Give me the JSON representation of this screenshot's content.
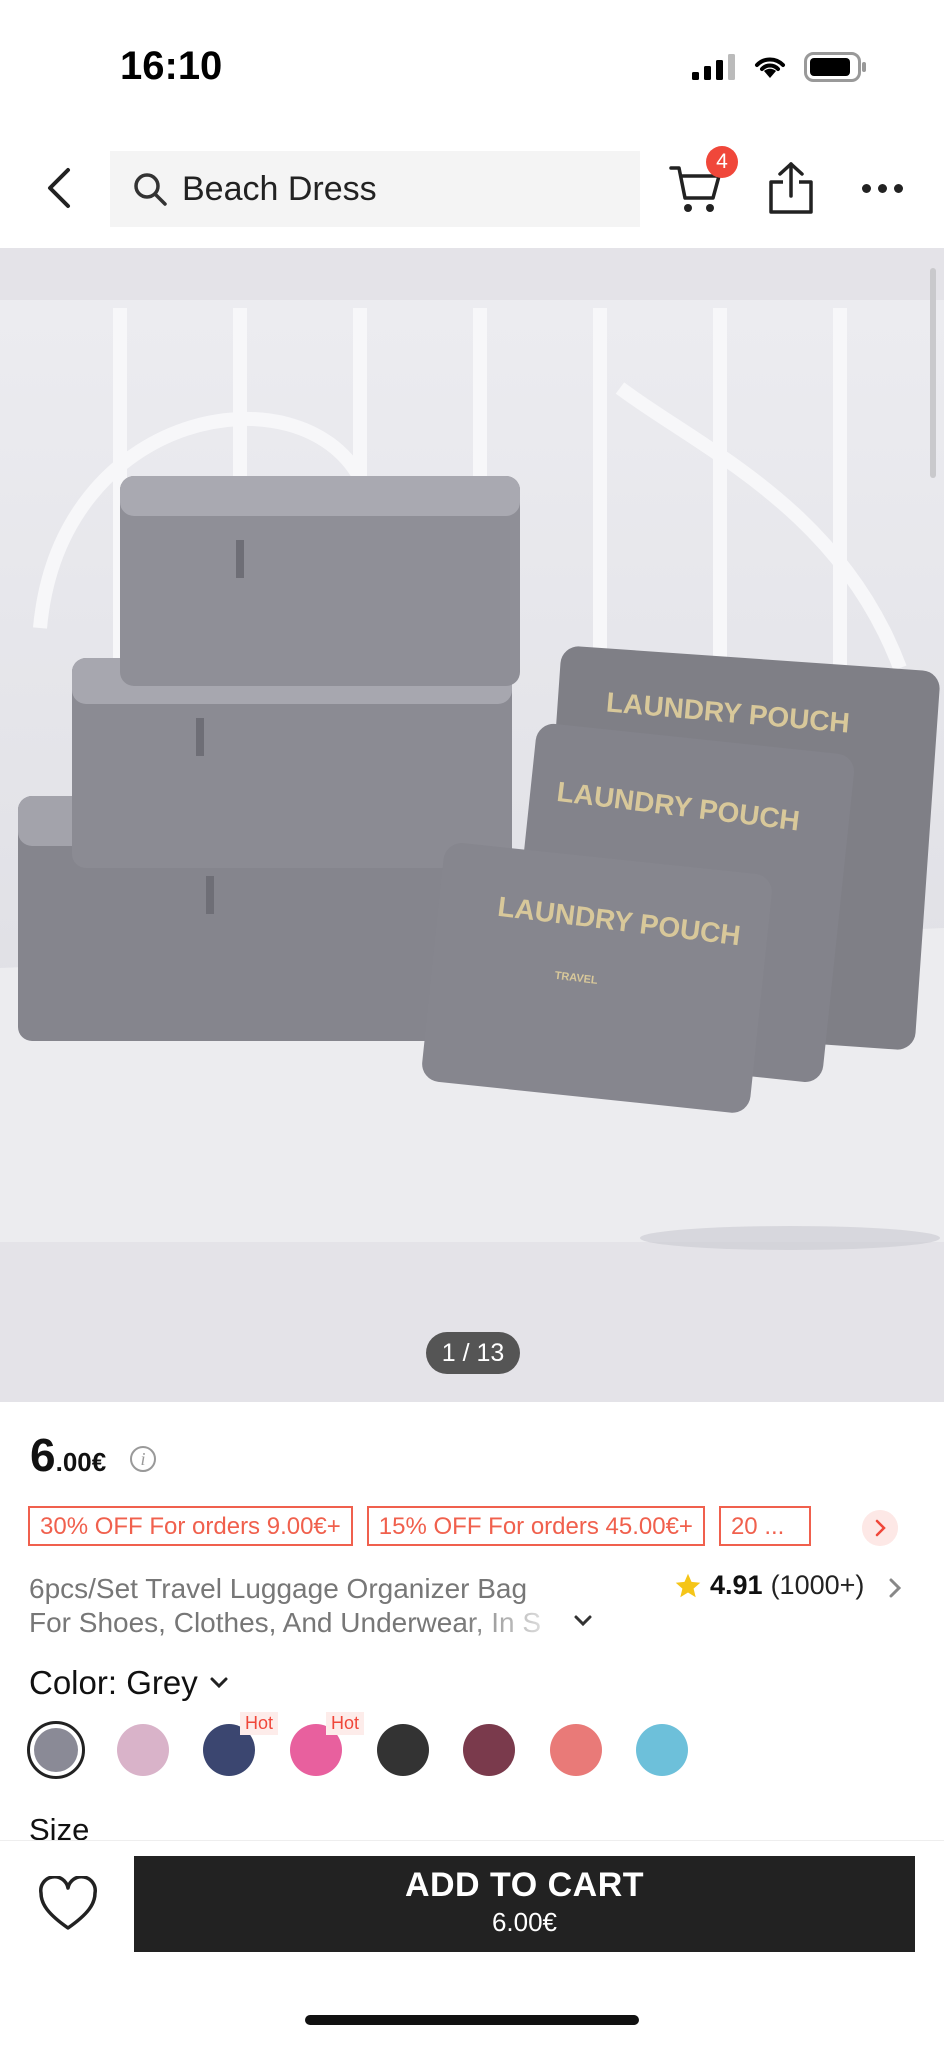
{
  "status_bar": {
    "time": "16:10"
  },
  "nav": {
    "search_text": "Beach Dress",
    "cart_count": "4"
  },
  "gallery": {
    "pager": "1 / 13",
    "pouch_text": "LAUNDRY POUCH",
    "pouch_subtext": "TRAVEL"
  },
  "price": {
    "integer": "6",
    "decimal": ".00€"
  },
  "coupons": [
    "30% OFF For orders 9.00€+",
    "15% OFF For orders 45.00€+",
    "20 ..."
  ],
  "product": {
    "title_line1": "6pcs/Set Travel Luggage Organizer Bag",
    "title_line2": "For Shoes, Clothes, And Underwear, In S",
    "rating": "4.91",
    "review_count": "(1000+)"
  },
  "color": {
    "label": "Color: Grey",
    "swatches": [
      {
        "color": "#8a8a96",
        "selected": true
      },
      {
        "color": "#d9b3c9"
      },
      {
        "color": "#3b4670",
        "tag": "Hot"
      },
      {
        "color": "#e8609e",
        "tag": "Hot"
      },
      {
        "color": "#333333"
      },
      {
        "color": "#7a3a4c"
      },
      {
        "color": "#e97a78"
      },
      {
        "color": "#6dc0da"
      }
    ]
  },
  "size_label": "Size",
  "cta": {
    "label": "ADD TO CART",
    "price": "6.00€"
  },
  "colors": {
    "accent": "#f0473a",
    "coupon": "#f0604d",
    "button": "#222222"
  }
}
